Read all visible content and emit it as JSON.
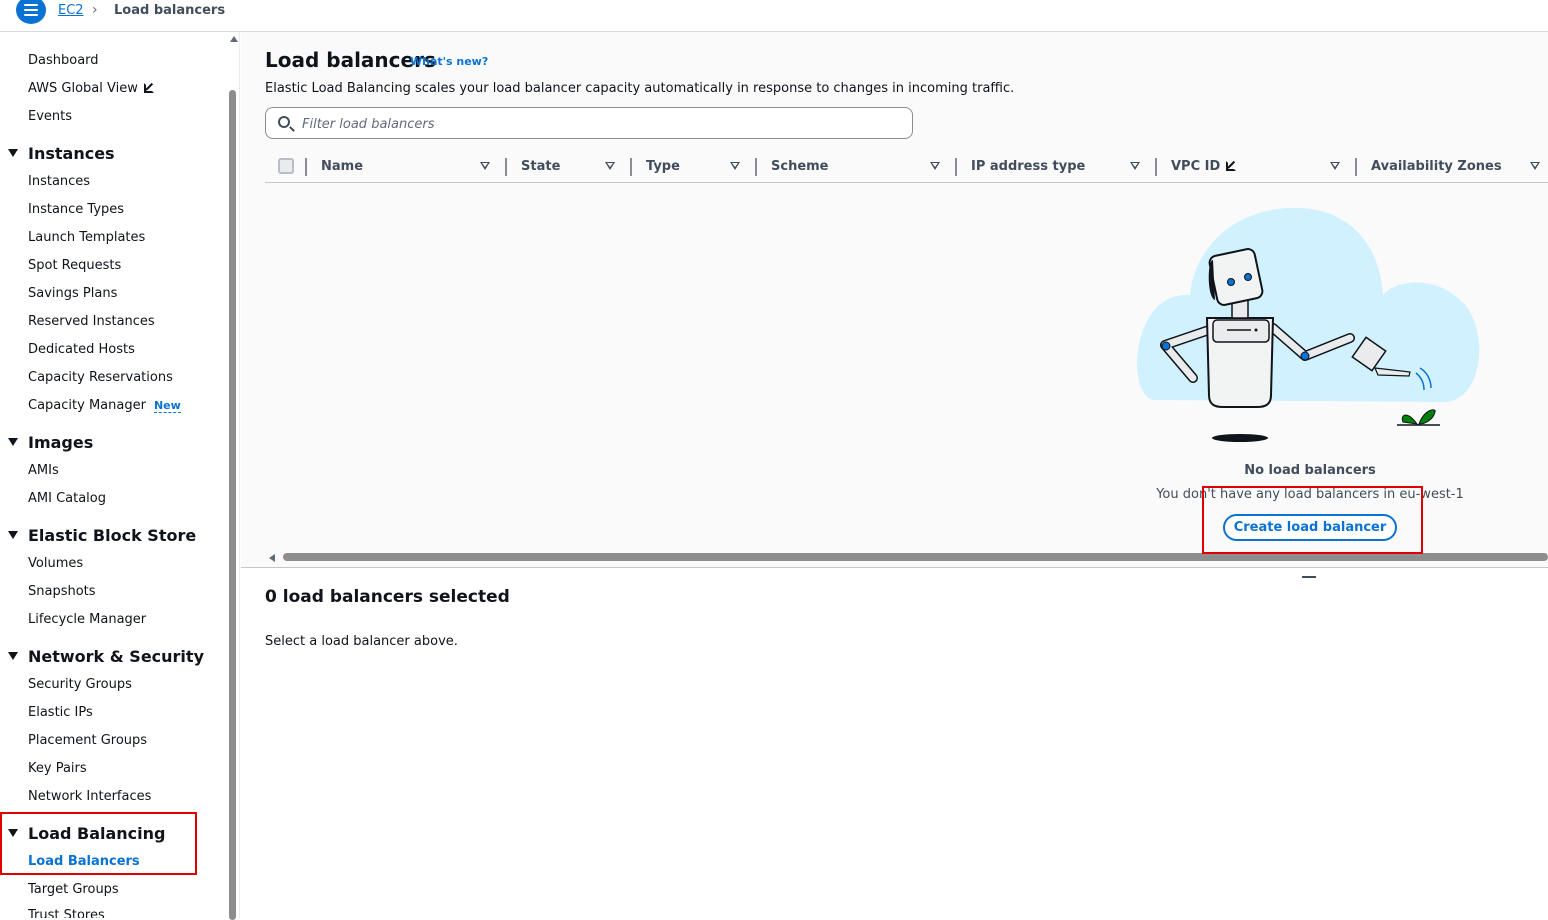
{
  "breadcrumb": {
    "root": "EC2",
    "separator": "›",
    "current": "Load balancers"
  },
  "sidebar": {
    "top_links": [
      "Dashboard",
      "AWS Global View",
      "Events"
    ],
    "sections": [
      {
        "title": "Instances",
        "items": [
          "Instances",
          "Instance Types",
          "Launch Templates",
          "Spot Requests",
          "Savings Plans",
          "Reserved Instances",
          "Dedicated Hosts",
          "Capacity Reservations",
          "Capacity Manager"
        ]
      },
      {
        "title": "Images",
        "items": [
          "AMIs",
          "AMI Catalog"
        ]
      },
      {
        "title": "Elastic Block Store",
        "items": [
          "Volumes",
          "Snapshots",
          "Lifecycle Manager"
        ]
      },
      {
        "title": "Network & Security",
        "items": [
          "Security Groups",
          "Elastic IPs",
          "Placement Groups",
          "Key Pairs",
          "Network Interfaces"
        ]
      },
      {
        "title": "Load Balancing",
        "items": [
          "Load Balancers",
          "Target Groups",
          "Trust Stores"
        ]
      }
    ],
    "new_badge": "New",
    "active_item": "Load Balancers"
  },
  "main": {
    "title": "Load balancers",
    "whats_new": "What's new?",
    "description": "Elastic Load Balancing scales your load balancer capacity automatically in response to changes in incoming traffic.",
    "search_placeholder": "Filter load balancers",
    "columns": [
      "Name",
      "State",
      "Type",
      "Scheme",
      "IP address type",
      "VPC ID",
      "Availability Zones"
    ],
    "empty_title": "No load balancers",
    "empty_desc": "You don't have any load balancers in eu-west-1",
    "create_button": "Create load balancer"
  },
  "split_panel": {
    "title": "0 load balancers selected",
    "desc": "Select a load balancer above."
  },
  "colors": {
    "accent": "#0972d3",
    "highlight": "#e00000"
  }
}
